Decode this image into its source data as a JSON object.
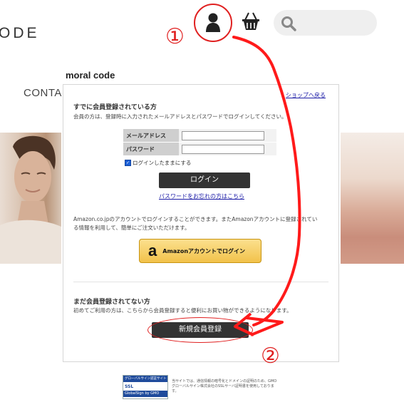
{
  "header": {
    "logo_text": "ODE",
    "search_placeholder": ""
  },
  "annotations": {
    "marker_one": "①",
    "marker_two": "②",
    "accent_color": "#e02020"
  },
  "nav": {
    "brand": "moral code",
    "contact": "CONTA"
  },
  "login_panel": {
    "back_link": "ショップへ戻る",
    "member_heading": "すでに会員登録されている方",
    "member_desc": "会員の方は、登録時に入力されたメールアドレスとパスワードでログインしてください。",
    "email_label": "メールアドレス",
    "email_value": "",
    "password_label": "パスワード",
    "password_value": "",
    "remember_label": "ログインしたままにする",
    "login_button": "ログイン",
    "forgot_link": "パスワードをお忘れの方はこちら",
    "amazon_desc_1": "Amazon.co.jpのアカウントでログインすることができます。またAmazonアカウントに登録されてい",
    "amazon_desc_2": "る情報を利用して、簡単にご注文いただけます。",
    "amazon_button": "Amazonアカウントでログイン",
    "amazon_mark": "a",
    "new_heading": "まだ会員登録されてない方",
    "new_desc": "初めてご利用の方は、こちらから会員登録すると便利にお買い物ができるようになります。",
    "register_button": "新規会員登録"
  },
  "footer": {
    "badge_top": "グローバルサイン認証サイト",
    "badge_mid": "SSL",
    "badge_bottom": "GlobalSign by GMO",
    "notice": "当サイトでは、通信情報の暗号化とドメインの証明のため、GMOグローバルサイン株式会社のSSLサーバ証明書を使用しております。"
  }
}
